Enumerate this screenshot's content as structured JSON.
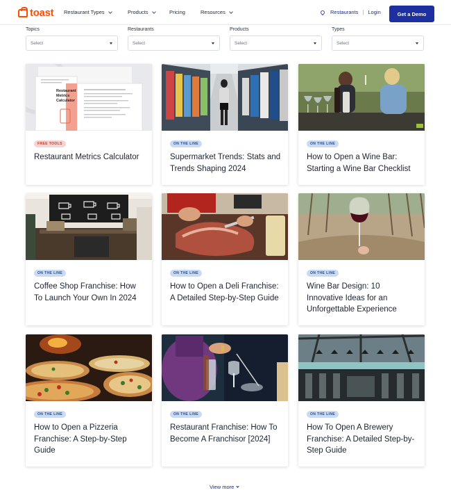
{
  "nav": {
    "logo": "toast",
    "items": [
      {
        "label": "Restaurant Types",
        "dropdown": true
      },
      {
        "label": "Products",
        "dropdown": true
      },
      {
        "label": "Pricing",
        "dropdown": false
      },
      {
        "label": "Resources",
        "dropdown": true
      }
    ],
    "location": "Restaurants",
    "login": "Login",
    "cta": "Get a Demo"
  },
  "filters": [
    {
      "label": "Topics",
      "value": "Select"
    },
    {
      "label": "Restaurants",
      "value": "Select"
    },
    {
      "label": "Products",
      "value": "Select"
    },
    {
      "label": "Types",
      "value": "Select"
    }
  ],
  "cards": [
    {
      "badge": "FREE TOOLS",
      "badge_style": "red",
      "title": "Restaurant Metrics Calculator",
      "image": "metrics-calculator-document"
    },
    {
      "badge": "ON THE LINE",
      "badge_style": "blue",
      "title": "Supermarket Trends: Stats and Trends Shaping 2024",
      "image": "supermarket-aisle"
    },
    {
      "badge": "ON THE LINE",
      "badge_style": "blue",
      "title": "How to Open a Wine Bar: Starting a Wine Bar Checklist",
      "image": "wine-tasting"
    },
    {
      "badge": "ON THE LINE",
      "badge_style": "blue",
      "title": "Coffee Shop Franchise: How To Launch Your Own In 2024",
      "image": "coffee-shop-counter"
    },
    {
      "badge": "ON THE LINE",
      "badge_style": "blue",
      "title": "How to Open a Deli Franchise: A Detailed Step-by-Step Guide",
      "image": "deli-ham-slicing"
    },
    {
      "badge": "ON THE LINE",
      "badge_style": "blue",
      "title": "Wine Bar Design: 10 Innovative Ideas for an Unforgettable Experience",
      "image": "wine-glass-vineyard"
    },
    {
      "badge": "ON THE LINE",
      "badge_style": "blue",
      "title": "How to Open a Pizzeria Franchise: A Step-by-Step Guide",
      "image": "pizzas-oven"
    },
    {
      "badge": "ON THE LINE",
      "badge_style": "blue",
      "title": "Restaurant Franchise: How To Become A Franchisor [2024]",
      "image": "bartender-pouring"
    },
    {
      "badge": "ON THE LINE",
      "badge_style": "blue",
      "title": "How To Open A Brewery Franchise: A Detailed Step-by-Step Guide",
      "image": "brewery-interior"
    }
  ],
  "view_more": "View more",
  "colors": {
    "brand": "#ff4c00",
    "cta": "#1e2fa0",
    "link": "#1e2a8a"
  }
}
